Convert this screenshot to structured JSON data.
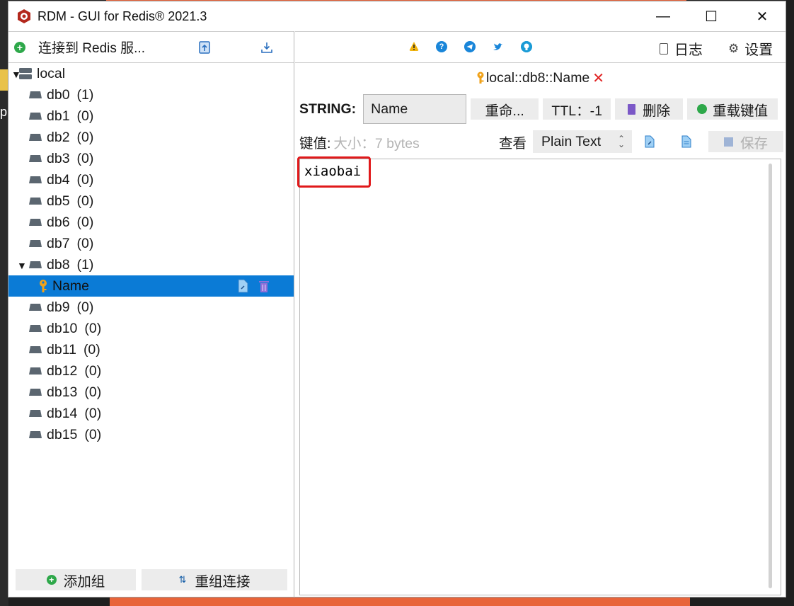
{
  "window": {
    "title": "RDM - GUI for Redis® 2021.3",
    "min_label": "—",
    "max_label": "☐",
    "close_label": "✕"
  },
  "left": {
    "connect_label": "连接到 Redis 服...",
    "server": {
      "name": "local",
      "arrow": "▼"
    },
    "databases": [
      {
        "name": "db0",
        "count": "(1)"
      },
      {
        "name": "db1",
        "count": "(0)"
      },
      {
        "name": "db2",
        "count": "(0)"
      },
      {
        "name": "db3",
        "count": "(0)"
      },
      {
        "name": "db4",
        "count": "(0)"
      },
      {
        "name": "db5",
        "count": "(0)"
      },
      {
        "name": "db6",
        "count": "(0)"
      },
      {
        "name": "db7",
        "count": "(0)"
      },
      {
        "name": "db8",
        "count": "(1)"
      },
      {
        "name": "db9",
        "count": "(0)"
      },
      {
        "name": "db10",
        "count": "(0)"
      },
      {
        "name": "db11",
        "count": "(0)"
      },
      {
        "name": "db12",
        "count": "(0)"
      },
      {
        "name": "db13",
        "count": "(0)"
      },
      {
        "name": "db14",
        "count": "(0)"
      },
      {
        "name": "db15",
        "count": "(0)"
      }
    ],
    "db8_arrow": "▼",
    "selected_key": "Name",
    "add_group_label": "添加组",
    "reorg_label": "重组连接"
  },
  "right": {
    "log_label": "日志",
    "settings_label": "设置",
    "tab_label": "local::db8::Name",
    "tab_close": "✕",
    "type_label": "STRING:",
    "key_name": "Name",
    "rename_label": "重命...",
    "ttl_label": "TTL：-1",
    "delete_label": "删除",
    "reload_label": "重载键值",
    "value_label": "键值:",
    "size_label": "大小：7 bytes",
    "view_label": "查看",
    "view_mode": "Plain Text",
    "save_label": "保存",
    "value_text": "xiaobai"
  },
  "colors": {
    "selection": "#0b7bd6",
    "highlight": "#e0191b",
    "accent_green": "#2ea84a"
  }
}
